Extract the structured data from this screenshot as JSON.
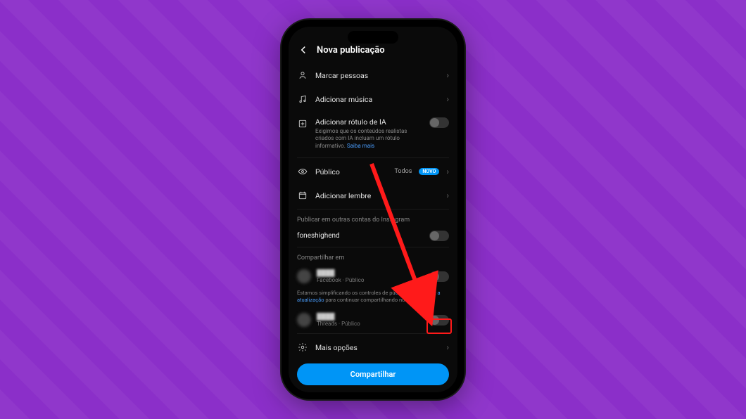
{
  "header": {
    "title": "Nova publicação"
  },
  "rows": {
    "tag_people": "Marcar pessoas",
    "add_music": "Adicionar música",
    "ai_label": "Adicionar rótulo de IA",
    "ai_sub": "Exigimos que os conteúdos realistas criados com IA incluam um rótulo informativo.",
    "ai_link": "Saiba mais",
    "audience": "Público",
    "audience_value": "Todos",
    "audience_badge": "NOVO",
    "add_reminder": "Adicionar lembre",
    "more_options": "Mais opções"
  },
  "sections": {
    "other_accounts": "Publicar em outras contas do Instagram",
    "share_on": "Compartilhar em"
  },
  "accounts": {
    "ig_account": "foneshighend",
    "fb_name": "████",
    "fb_sub": "Facebook · Público",
    "fb_disclaimer_pre": "Estamos simplificando os controles de pú",
    "fb_disclaimer_link": "tifique e confirme a atualização",
    "fb_disclaimer_post": " para continuar compartilhando no Facebook.",
    "th_name": "████",
    "th_sub": "Threads · Público"
  },
  "share_button": "Compartilhar"
}
